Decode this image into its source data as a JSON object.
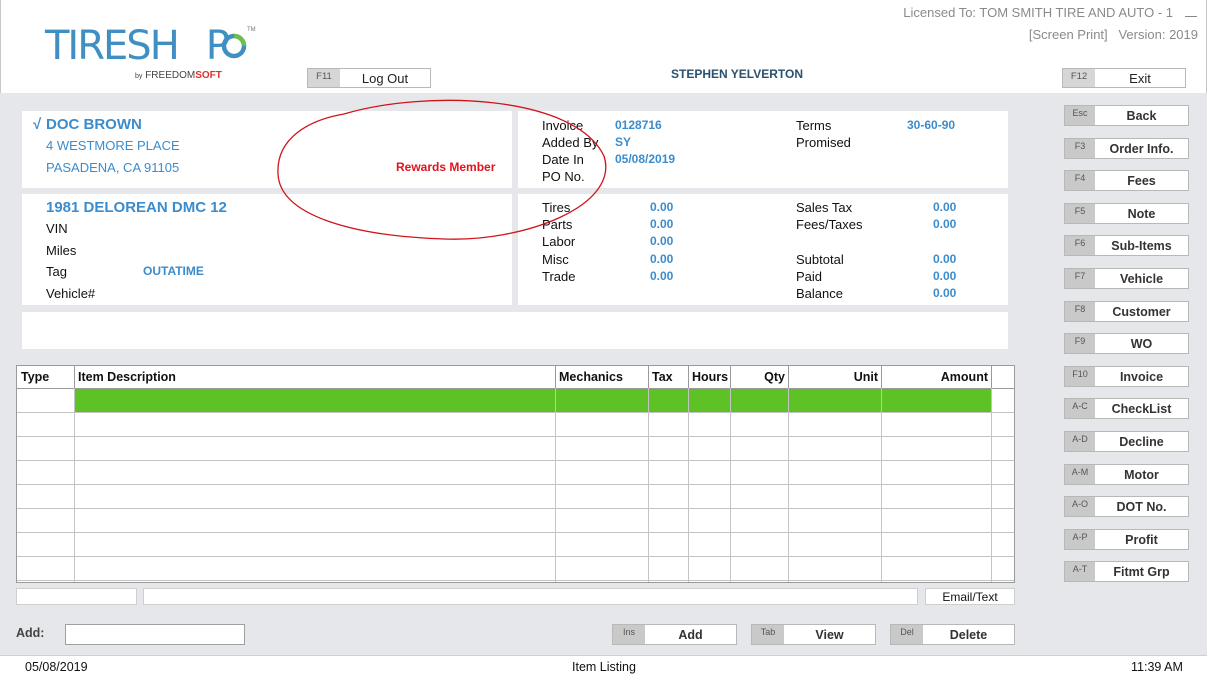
{
  "header": {
    "logo_text": "TIRESH",
    "logo_text_end": "P",
    "logo_by": "by",
    "logo_freedom": "FREEDOM",
    "logo_soft": "SOFT",
    "license": "Licensed To: TOM SMITH TIRE AND AUTO - 1",
    "screen_print": "[Screen Print]   Version: 2019",
    "logout_key": "F11",
    "logout_label": "Log Out",
    "user_name": "STEPHEN YELVERTON",
    "exit_key": "F12",
    "exit_label": "Exit"
  },
  "customer": {
    "check": "√",
    "name": "DOC BROWN",
    "address1": "4 WESTMORE PLACE",
    "address2": "PASADENA, CA  91105",
    "rewards": "Rewards Member"
  },
  "invoice": {
    "invoice_label": "Invoice",
    "invoice_value": "0128716",
    "added_by_label": "Added By",
    "added_by_value": "SY",
    "date_in_label": "Date In",
    "date_in_value": "05/08/2019",
    "po_label": "PO No.",
    "terms_label": "Terms",
    "terms_value": "30-60-90",
    "promised_label": "Promised"
  },
  "vehicle": {
    "title": "1981 DELOREAN DMC 12",
    "vin_label": "VIN",
    "miles_label": "Miles",
    "tag_label": "Tag",
    "tag_value": "OUTATIME",
    "vehicle_no_label": "Vehicle#"
  },
  "totals": {
    "tires_label": "Tires",
    "tires_value": "0.00",
    "parts_label": "Parts",
    "parts_value": "0.00",
    "labor_label": "Labor",
    "labor_value": "0.00",
    "misc_label": "Misc",
    "misc_value": "0.00",
    "trade_label": "Trade",
    "trade_value": "0.00",
    "sales_tax_label": "Sales Tax",
    "sales_tax_value": "0.00",
    "fees_taxes_label": "Fees/Taxes",
    "fees_taxes_value": "0.00",
    "subtotal_label": "Subtotal",
    "subtotal_value": "0.00",
    "paid_label": "Paid",
    "paid_value": "0.00",
    "balance_label": "Balance",
    "balance_value": "0.00"
  },
  "side_buttons": [
    {
      "key": "Esc",
      "label": "Back"
    },
    {
      "key": "F3",
      "label": "Order Info."
    },
    {
      "key": "F4",
      "label": "Fees"
    },
    {
      "key": "F5",
      "label": "Note"
    },
    {
      "key": "F6",
      "label": "Sub-Items"
    },
    {
      "key": "F7",
      "label": "Vehicle"
    },
    {
      "key": "F8",
      "label": "Customer"
    },
    {
      "key": "F9",
      "label": "WO"
    },
    {
      "key": "F10",
      "label": "Invoice"
    },
    {
      "key": "A-C",
      "label": "CheckList"
    },
    {
      "key": "A-D",
      "label": "Decline"
    },
    {
      "key": "A-M",
      "label": "Motor"
    },
    {
      "key": "A-O",
      "label": "DOT No."
    },
    {
      "key": "A-P",
      "label": "Profit"
    },
    {
      "key": "A-T",
      "label": "Fitmt Grp"
    }
  ],
  "grid": {
    "columns": [
      "Type",
      "Item Description",
      "Mechanics",
      "Tax",
      "Hours",
      "Qty",
      "Unit",
      "Amount"
    ],
    "selected_row_color": "#5ec227"
  },
  "footer_controls": {
    "email_text": "Email/Text",
    "add_label": "Add:",
    "add_value": "",
    "ins_key": "Ins",
    "add_button": "Add",
    "tab_key": "Tab",
    "view_button": "View",
    "del_key": "Del",
    "delete_button": "Delete"
  },
  "status_bar": {
    "date": "05/08/2019",
    "screen": "Item Listing",
    "time": "11:39 AM"
  },
  "colors": {
    "accent_blue": "#3b8ccd",
    "rewards_red": "#e0141c",
    "annotation_red": "#d0141c"
  }
}
